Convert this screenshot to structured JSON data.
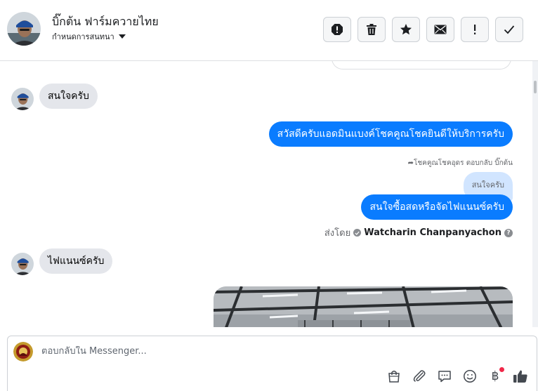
{
  "header": {
    "contact_name": "บิ๊กต้น ฟาร์มควายไทย",
    "assign_label": "กำหนดการสนทนา",
    "actions": [
      {
        "name": "spam-button",
        "icon": "alert-circle-icon"
      },
      {
        "name": "delete-button",
        "icon": "trash-icon"
      },
      {
        "name": "star-button",
        "icon": "star-icon"
      },
      {
        "name": "mark-unread-button",
        "icon": "envelope-icon"
      },
      {
        "name": "follow-up-button",
        "icon": "exclamation-icon"
      },
      {
        "name": "mark-done-button",
        "icon": "check-icon"
      }
    ]
  },
  "messages": {
    "m1": "สนใจครับ",
    "m2": "สวัสดีครับแอดมินแบงค์โชคคูณโชคยินดีให้บริการครับ",
    "reply_meta": "โชคคูณโชคอุดร ตอบกลับ บิ๊กต้น",
    "quoted": "สนใจครับ",
    "m3": "สนใจซื้อสดหรือจัดไฟแนนซ์ครับ",
    "sent_by_label": "ส่งโดย",
    "sender": "Watcharin Chanpanyachon",
    "m4": "ไฟแนนซ์ครับ"
  },
  "composer": {
    "placeholder": "ตอบกลับใน Messenger..."
  },
  "colors": {
    "accent": "#0a7cff",
    "incoming": "#e4e6eb",
    "quote": "#d1e5ff",
    "badge": "#f02849"
  }
}
